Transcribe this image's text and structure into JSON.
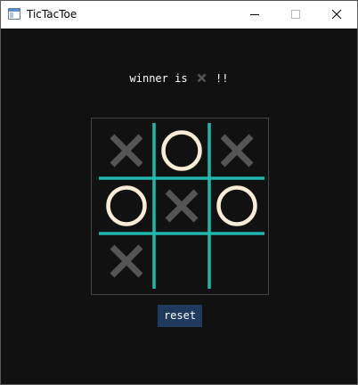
{
  "window": {
    "title": "TicTacToe",
    "icon": "app-window-icon",
    "controls": [
      "minimize-icon",
      "maximize-icon",
      "close-icon"
    ]
  },
  "status": {
    "prefix": "winner is ",
    "winner": "X",
    "suffix": " !!"
  },
  "board": {
    "cells": [
      "X",
      "O",
      "X",
      "O",
      "X",
      "O",
      "X",
      "",
      ""
    ],
    "colors": {
      "x": "#555555",
      "o_stroke": "#f8ecd6",
      "grid": "#1fb6ac"
    }
  },
  "reset": {
    "label": "reset",
    "color": "#1f3a5c"
  }
}
